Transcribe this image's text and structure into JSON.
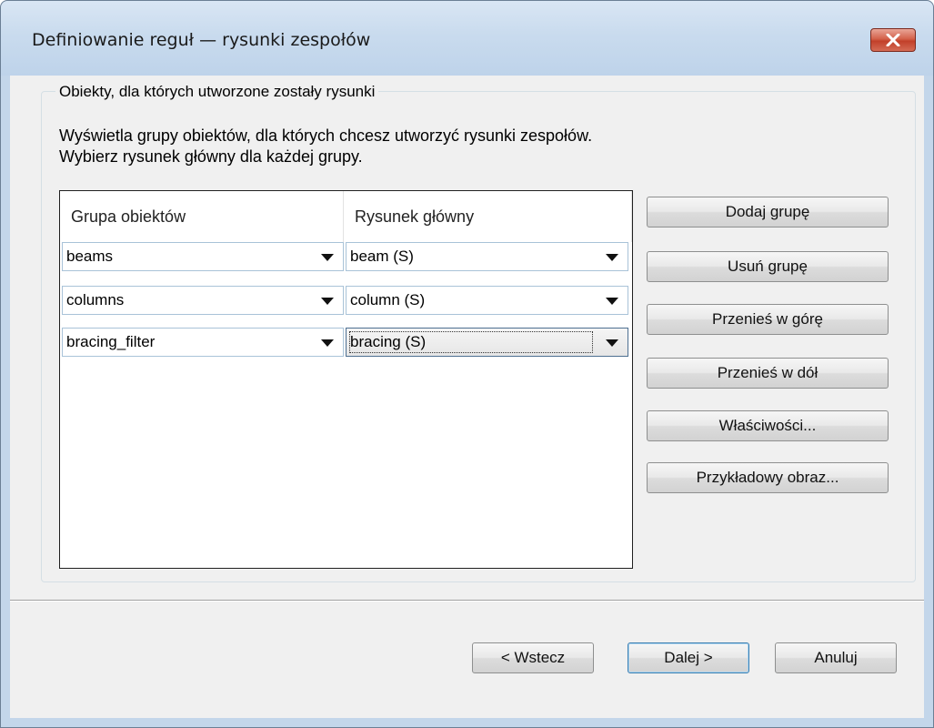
{
  "window": {
    "title": "Definiowanie reguł — rysunki zespołów"
  },
  "group_box": {
    "legend": "Obiekty, dla których utworzone zostały rysunki",
    "description_line1": "Wyświetla grupy obiektów, dla których chcesz utworzyć rysunki zespołów.",
    "description_line2": "Wybierz rysunek główny dla każdej grupy."
  },
  "grid": {
    "headers": [
      "Grupa obiektów",
      "Rysunek główny"
    ],
    "rows": [
      {
        "group": "beams",
        "drawing": "beam (S)"
      },
      {
        "group": "columns",
        "drawing": "column (S)"
      },
      {
        "group": "bracing_filter",
        "drawing": "bracing (S)"
      }
    ]
  },
  "side_buttons": {
    "add_group": "Dodaj grupę",
    "remove_group": "Usuń grupę",
    "move_up": "Przenieś w górę",
    "move_down": "Przenieś w dół",
    "properties": "Właściwości...",
    "sample_image": "Przykładowy obraz..."
  },
  "footer": {
    "back": "< Wstecz",
    "next": "Dalej >",
    "cancel": "Anuluj"
  },
  "colors": {
    "titlebar": "#c3d6ea",
    "dialog_bg": "#f0f0f0",
    "close_button": "#c2402a"
  }
}
